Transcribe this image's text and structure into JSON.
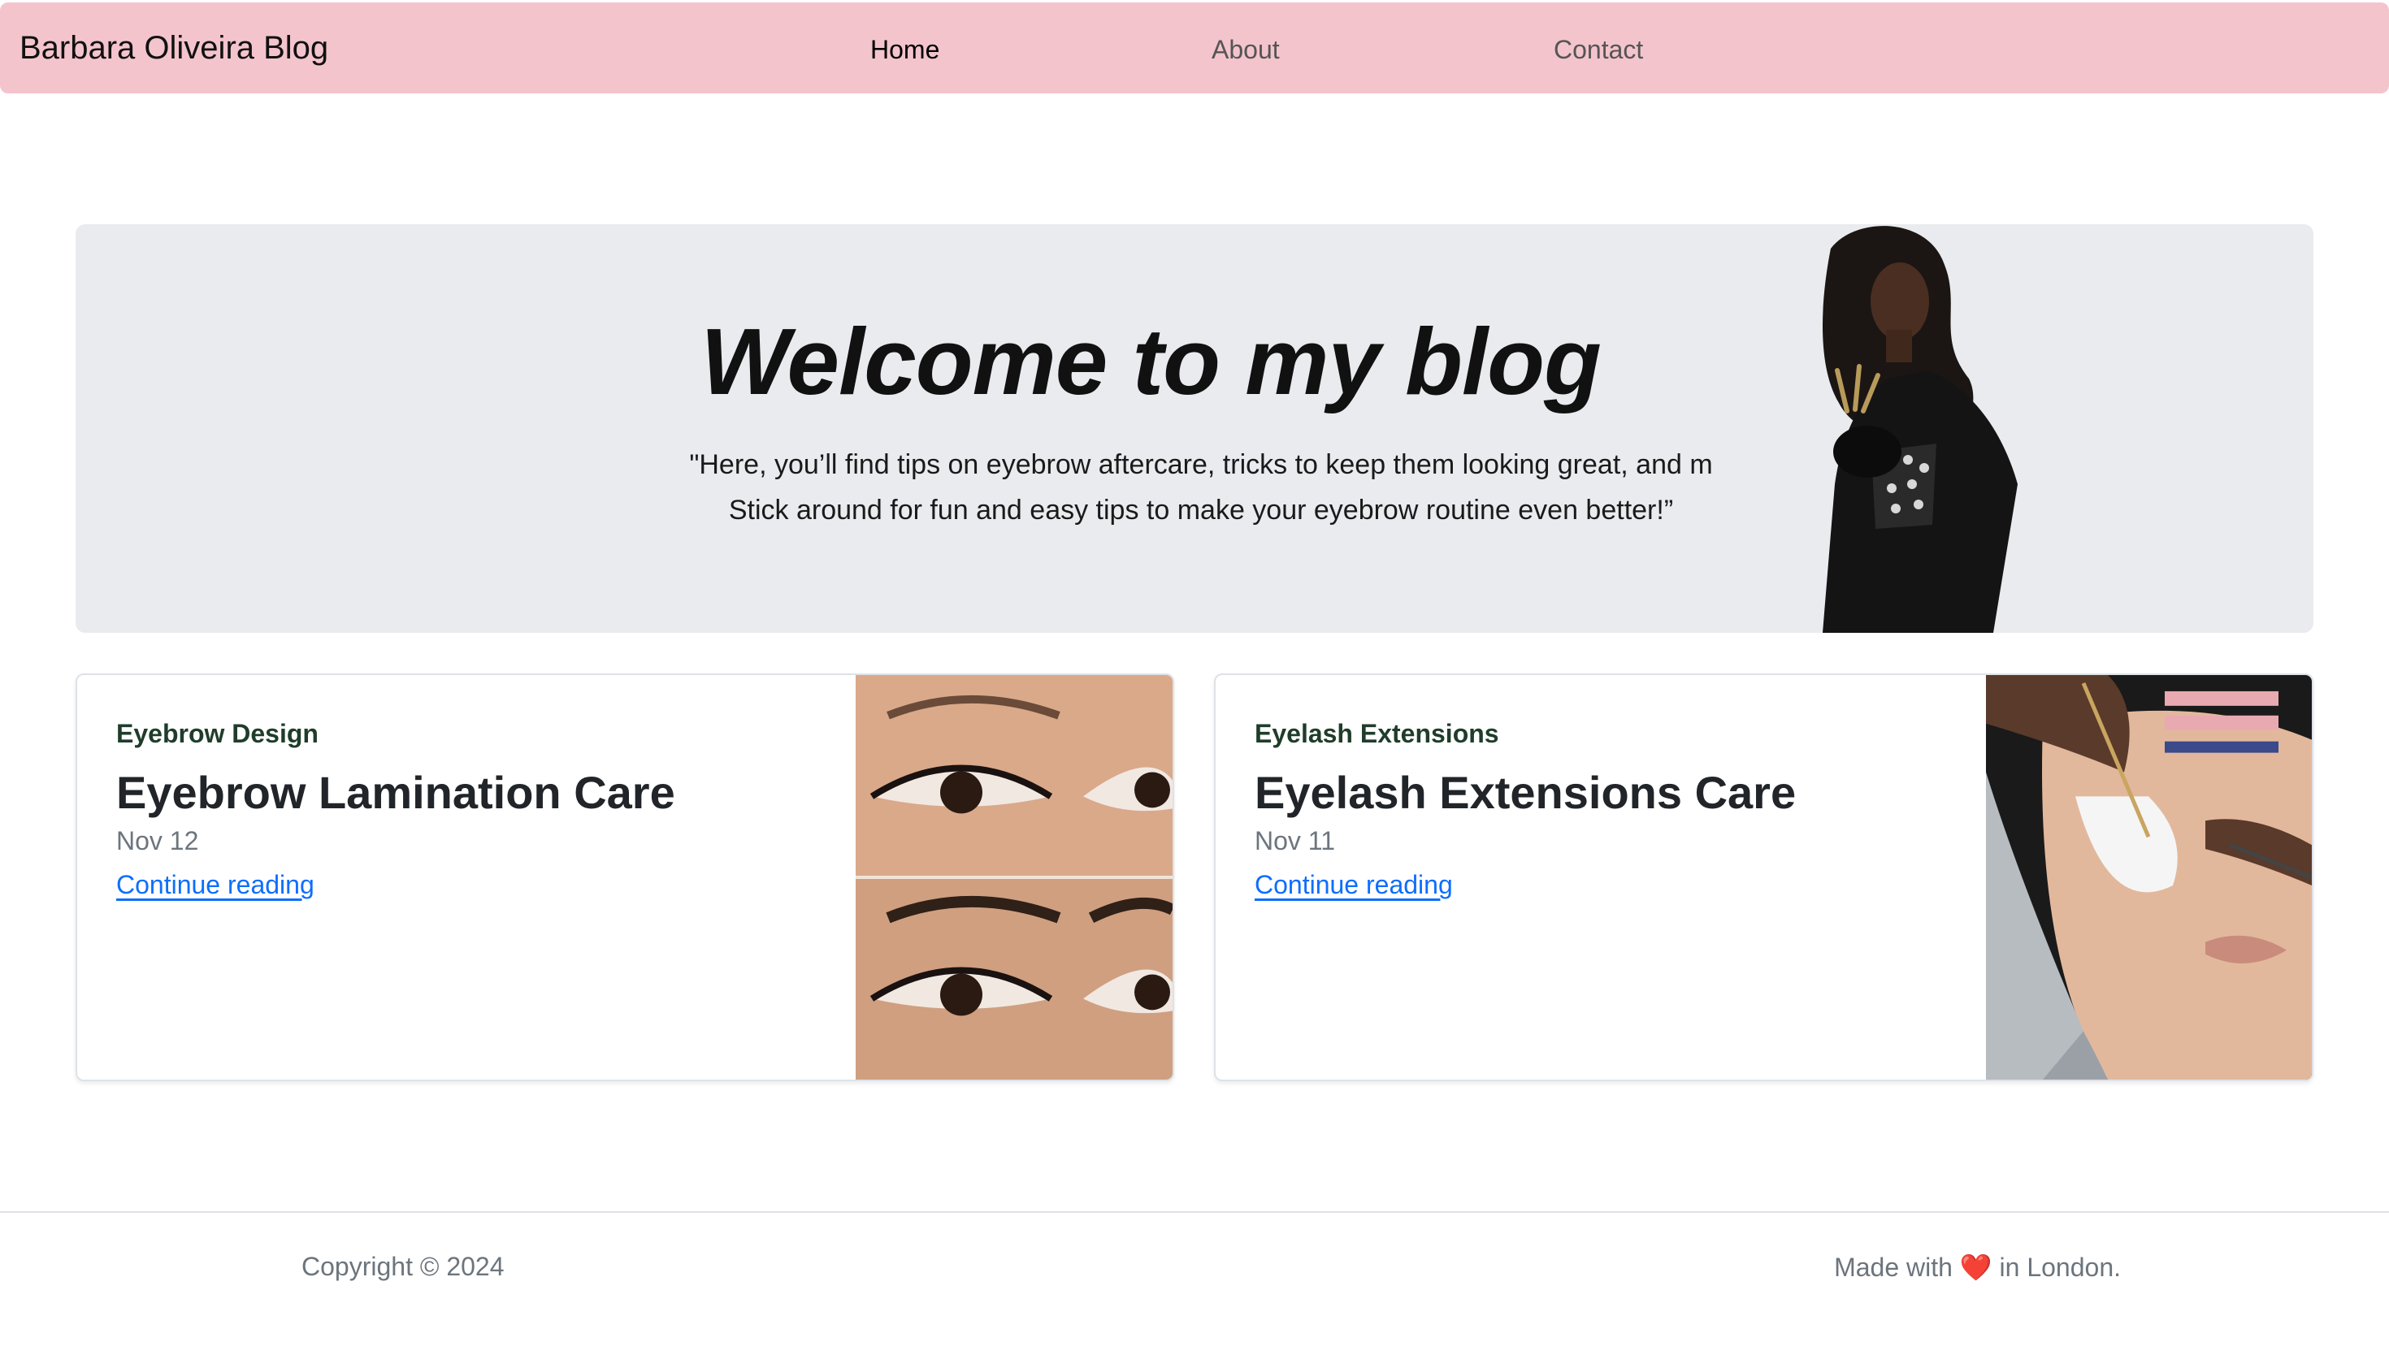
{
  "navbar": {
    "brand": "Barbara Oliveira Blog",
    "links": [
      {
        "label": "Home",
        "active": true
      },
      {
        "label": "About",
        "active": false
      },
      {
        "label": "Contact",
        "active": false
      }
    ],
    "background": "#f4c4cd"
  },
  "hero": {
    "title": "Welcome to my blog",
    "quote_line1": "\"Here, you’ll find tips on eyebrow aftercare, tricks to keep them looking great, and m",
    "quote_line2": "Stick around for fun and easy tips to make your eyebrow routine even better!”"
  },
  "posts": [
    {
      "category": "Eyebrow Design",
      "title": "Eyebrow Lamination Care",
      "date": "Nov 12",
      "link": "Continue reading"
    },
    {
      "category": "Eyelash Extensions",
      "title": "Eyelash Extensions Care",
      "date": "Nov 11",
      "link": "Continue reading"
    }
  ],
  "footer": {
    "copyright": "Copyright © 2024",
    "made_with_prefix": "Made with",
    "heart": "❤️",
    "made_with_suffix": "in London."
  }
}
